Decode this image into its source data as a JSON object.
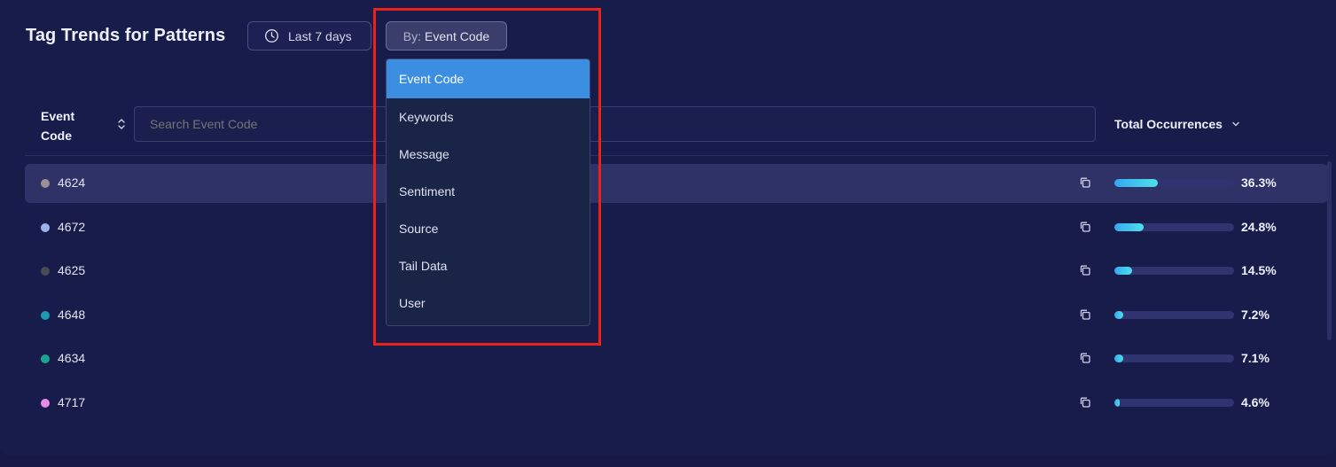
{
  "header": {
    "title": "Tag Trends for Patterns",
    "time_button_label": "Last 7 days",
    "group_prefix": "By:",
    "group_value": "Event Code"
  },
  "table": {
    "first_column_label": "Event Code",
    "search_placeholder": "Search Event Code",
    "total_column_label": "Total Occurrences",
    "rows": [
      {
        "code": "4624",
        "percent": "36.3%",
        "fraction": 0.363,
        "dot_color": "#9e8f95",
        "selected": true
      },
      {
        "code": "4672",
        "percent": "24.8%",
        "fraction": 0.248,
        "dot_color": "#9bb2e8",
        "selected": false
      },
      {
        "code": "4625",
        "percent": "14.5%",
        "fraction": 0.145,
        "dot_color": "#4b4b4f",
        "selected": false
      },
      {
        "code": "4648",
        "percent": "7.2%",
        "fraction": 0.072,
        "dot_color": "#1e97b3",
        "selected": false
      },
      {
        "code": "4634",
        "percent": "7.1%",
        "fraction": 0.071,
        "dot_color": "#1aa58e",
        "selected": false
      },
      {
        "code": "4717",
        "percent": "4.6%",
        "fraction": 0.046,
        "dot_color": "#e68be8",
        "selected": false
      }
    ]
  },
  "dropdown": {
    "options": [
      "Event Code",
      "Keywords",
      "Message",
      "Sentiment",
      "Source",
      "Tail Data",
      "User"
    ],
    "selected_index": 0
  },
  "colors": {
    "background": "#181c4a",
    "accent": "#3b8ee0",
    "highlight_border": "#e8231a"
  }
}
